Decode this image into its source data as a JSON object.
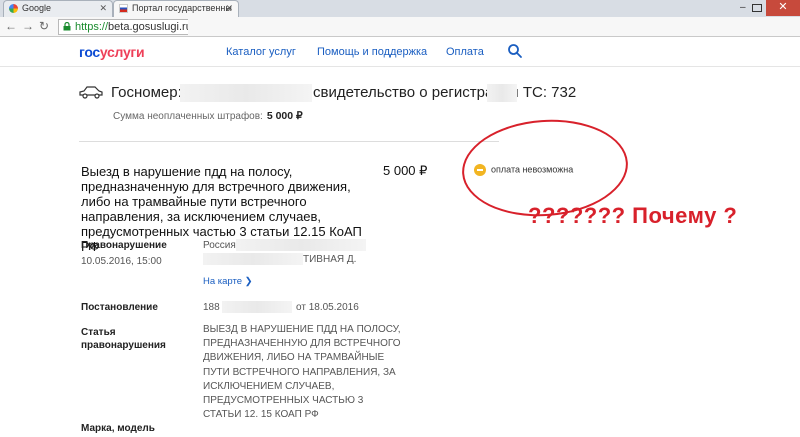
{
  "browser": {
    "tabs": [
      {
        "title": "Google",
        "active": false
      },
      {
        "title": "Портал государственны",
        "active": true
      }
    ],
    "address": {
      "secure_label": "https://",
      "url": "beta.gosuslugi.ru/",
      "tail": "1("
    },
    "controls": {
      "close": "✕",
      "minimize": "–"
    }
  },
  "header": {
    "logo_part1": "гос",
    "logo_part2": "услуги",
    "nav": [
      "Каталог услуг",
      "Помощь и поддержка",
      "Оплата"
    ]
  },
  "vehicle": {
    "plate_label": "Госномер:",
    "doc_text": "свидетельство о регистрации ТС: 732",
    "fine_sum_label": "Сумма неоплаченных штрафов:",
    "fine_sum_value": "5 000 ₽"
  },
  "violation": {
    "title": "Выезд в нарушение пдд на полосу, предназначенную для встречного движения, либо на трамвайные пути встречного направления, за исключением случаев, предусмотренных частью 3 статьи 12.15 КоАП РФ",
    "amount": "5 000 ₽",
    "status": "оплата невозможна",
    "annotation": "??????? Почему ?",
    "offense_label": "Правонарушение",
    "offense_date": "10.05.2016, 15:00",
    "offense_place_1": "Россия",
    "offense_place_2": "ТИВНАЯ Д.",
    "map_link": "На карте ❯",
    "decree_label": "Постановление",
    "decree_prefix": "188",
    "decree_suffix": "от 18.05.2016",
    "article_label_1": "Статья",
    "article_label_2": "правонарушения",
    "article_text": "ВЫЕЗД В НАРУШЕНИЕ ПДД НА ПОЛОСУ, ПРЕДНАЗНАЧЕННУЮ ДЛЯ ВСТРЕЧНОГО ДВИЖЕНИЯ, ЛИБО НА ТРАМВАЙНЫЕ ПУТИ ВСТРЕЧНОГО НАПРАВЛЕНИЯ, ЗА ИСКЛЮЧЕНИЕМ СЛУЧАЕВ, ПРЕДУСМОТРЕННЫХ ЧАСТЬЮ 3 СТАТЬИ 12. 15 КОАП РФ",
    "model_label": "Марка, модель"
  },
  "colors": {
    "brand_blue": "#0d4cd3",
    "brand_red": "#ee3f58",
    "link": "#1a5ec1",
    "status_dot": "#f2b522",
    "annotation_red": "#d8212b"
  },
  "icons": [
    "google-favicon",
    "russia-flag-favicon",
    "lock-icon",
    "car-icon",
    "search-icon",
    "status-dot-icon"
  ]
}
